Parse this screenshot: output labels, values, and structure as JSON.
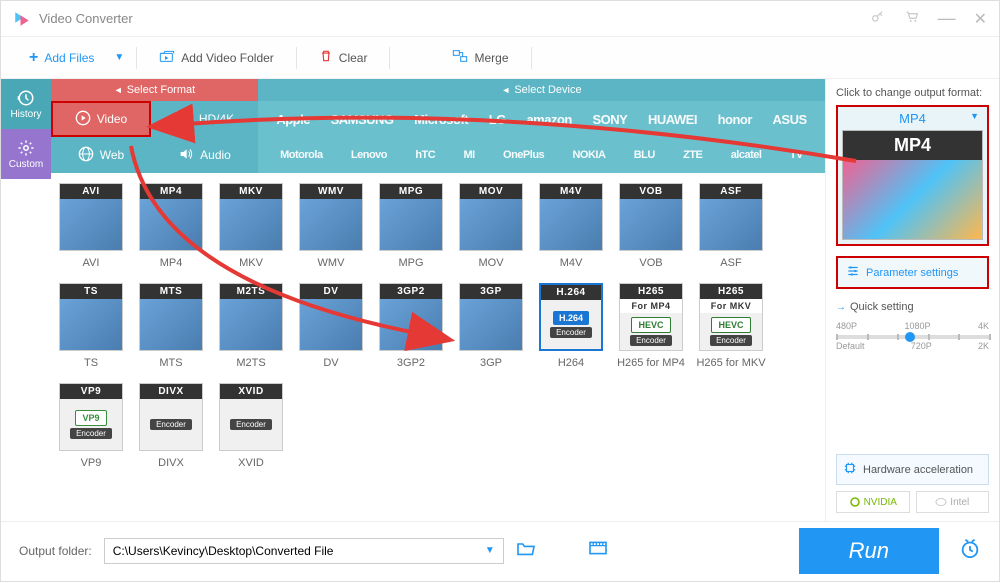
{
  "titlebar": {
    "title": "Video Converter"
  },
  "toolbar": {
    "add_files": "Add Files",
    "add_folder": "Add Video Folder",
    "clear": "Clear",
    "merge": "Merge"
  },
  "side": {
    "history": "History",
    "custom": "Custom"
  },
  "fmt_header": {
    "select_format": "Select Format",
    "select_device": "Select Device"
  },
  "categories": {
    "video": "Video",
    "hd": "HD/4K",
    "web": "Web",
    "audio": "Audio"
  },
  "brands_row1": [
    "Apple",
    "SAMSUNG",
    "Microsoft",
    "LG",
    "amazon",
    "SONY",
    "HUAWEI",
    "honor",
    "ASUS"
  ],
  "brands_row2": [
    "Motorola",
    "Lenovo",
    "hTC",
    "MI",
    "OnePlus",
    "NOKIA",
    "BLU",
    "ZTE",
    "alcatel",
    "TV"
  ],
  "formats": [
    {
      "badge": "AVI",
      "label": "AVI",
      "type": "media"
    },
    {
      "badge": "MP4",
      "label": "MP4",
      "type": "media"
    },
    {
      "badge": "MKV",
      "label": "MKV",
      "type": "media"
    },
    {
      "badge": "WMV",
      "label": "WMV",
      "type": "media"
    },
    {
      "badge": "MPG",
      "label": "MPG",
      "type": "media"
    },
    {
      "badge": "MOV",
      "label": "MOV",
      "type": "media"
    },
    {
      "badge": "M4V",
      "label": "M4V",
      "type": "media"
    },
    {
      "badge": "VOB",
      "label": "VOB",
      "type": "media"
    },
    {
      "badge": "ASF",
      "label": "ASF",
      "type": "media"
    },
    {
      "badge": "TS",
      "label": "TS",
      "type": "media"
    },
    {
      "badge": "MTS",
      "label": "MTS",
      "type": "media"
    },
    {
      "badge": "M2TS",
      "label": "M2TS",
      "type": "media"
    },
    {
      "badge": "DV",
      "label": "DV",
      "type": "media"
    },
    {
      "badge": "3GP2",
      "label": "3GP2",
      "type": "media"
    },
    {
      "badge": "3GP",
      "label": "3GP",
      "type": "media"
    },
    {
      "badge": "H.264",
      "label": "H264",
      "type": "encoder",
      "codec": "H.264",
      "selected": true
    },
    {
      "badge": "H265",
      "sub": "For MP4",
      "label": "H265 for MP4",
      "type": "encoder",
      "codec": "HEVC"
    },
    {
      "badge": "H265",
      "sub": "For MKV",
      "label": "H265 for MKV",
      "type": "encoder",
      "codec": "HEVC"
    },
    {
      "badge": "VP9",
      "label": "VP9",
      "type": "encoder",
      "codec": "VP9"
    },
    {
      "badge": "DIVX",
      "label": "DIVX",
      "type": "encoder",
      "codec": ""
    },
    {
      "badge": "XVID",
      "label": "XVID",
      "type": "encoder",
      "codec": ""
    }
  ],
  "right": {
    "click_label": "Click to change output format:",
    "output_format": "MP4",
    "big_badge": "MP4",
    "param_settings": "Parameter settings",
    "quick_setting": "Quick setting",
    "res_labels_top": [
      "480P",
      "1080P",
      "4K"
    ],
    "res_labels_bottom": [
      "Default",
      "720P",
      "2K"
    ],
    "hw_accel": "Hardware acceleration",
    "nvidia": "NVIDIA",
    "intel": "Intel"
  },
  "bottom": {
    "label": "Output folder:",
    "path": "C:\\Users\\Kevincy\\Desktop\\Converted File",
    "run": "Run"
  }
}
